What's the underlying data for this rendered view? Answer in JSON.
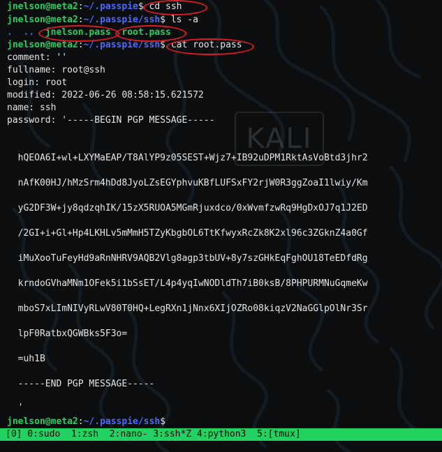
{
  "prompt": {
    "user": "jnelson",
    "at": "@",
    "host": "meta2",
    "colon": ":",
    "dollar": "$"
  },
  "lines": {
    "l1_path": "~/.passpie",
    "l1_cmd": "cd ssh",
    "l2_path": "~/.passpie/ssh",
    "l2_cmd": "ls -a",
    "l3_dot": ".",
    "l3_dotdot": "..",
    "l3_file1": "jnelson.pass",
    "l3_file2": "root.pass",
    "l4_path": "~/.passpie/ssh",
    "l4_cmd": "cat root.pass",
    "final_path": "~/.passpie/ssh"
  },
  "output": [
    "comment: ''",
    "fullname: root@ssh",
    "login: root",
    "modified: 2022-06-26 08:58:15.621572",
    "name: ssh",
    "password: '-----BEGIN PGP MESSAGE-----"
  ],
  "pgp": [
    "  hQEOA6I+wl+LXYMaEAP/T8AlYP9z05SEST+Wjz7+IB92uDPM1RktAsVoBtd3jhr2",
    "  nAfK00HJ/hMzSrm4hDd8JyoLZsEGYphvuKBfLUFSxFY2rjW0R3ggZoaI1lwiy/Km",
    "  yG2DF3W+jy8qdzqhIK/15zX5RUOA5MGmRjuxdco/0xWvmfzwRq9HgDxOJ7q1J2ED",
    "  /2GI+i+Gl+Hp4LKHLv5mMmH5TZyKbgbOL6TtKfwyxRcZk8K2xl96c3ZGknZ4a0Gf",
    "  iMuXooTuFeyHd9aRnNHRV9AQB2Vlg8agp3tbUV+8y7szGHkEqFghOU18TeEDfdRg",
    "  krndoGVhaMNm1OFek5i1bSsET/L4p4yqIwNODldTh7iB0ksB/8PHPURMNuGqmeKw",
    "  mboS7xLImNIVyRLwV80T0HQ+LegRXn1jNnx6XIjOZRo08kiqzV2NaGGlpOlNr3Sr",
    "  lpF0RatbxQGWBks5F3o=",
    "  =uh1B",
    "  -----END PGP MESSAGE-----",
    "  '"
  ],
  "watermark": "KALI",
  "tmux": {
    "status": "[0] 0:sudo  1:zsh  2:nano- 3:ssh*Z 4:python3  5:[tmux]"
  },
  "colors": {
    "prompt_green": "#23d160",
    "path_blue": "#4a6cff",
    "highlight_red": "#e01b24",
    "background": "#0b0d0f"
  }
}
